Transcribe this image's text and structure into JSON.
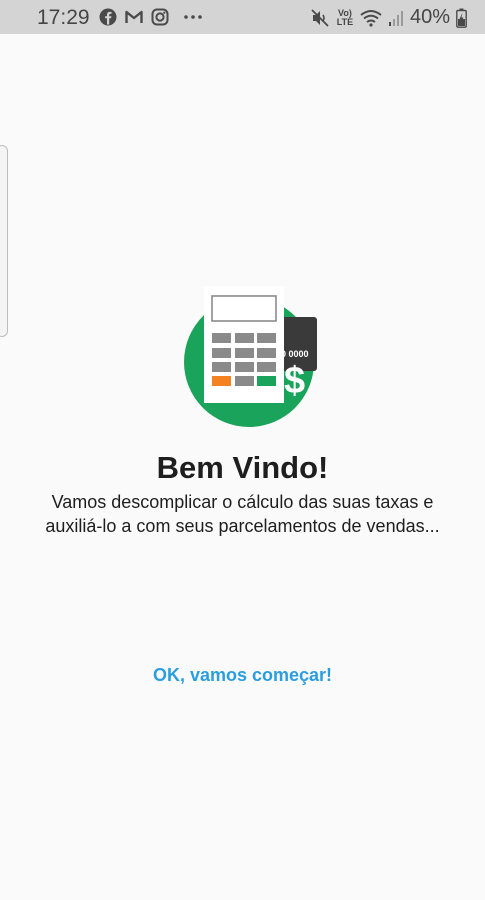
{
  "status_bar": {
    "time": "17:29",
    "battery_percent": "40%",
    "volte_top": "Vo)",
    "volte_bottom": "LTE",
    "left_icons": [
      "facebook-icon",
      "gmail-icon",
      "instagram-icon",
      "more-dots-icon"
    ],
    "right_icons": [
      "mute-vibrate-icon",
      "volte-icon",
      "wifi-icon",
      "signal-icon",
      "battery-charging-icon"
    ]
  },
  "illustration": {
    "name": "calculator-card-illustration",
    "colors": {
      "circle": "#1aa35a",
      "calculator_body": "#ffffff",
      "key": "#8a8a8a",
      "key_orange": "#f58220",
      "key_green": "#1aa35a",
      "card": "#3a3a3a",
      "dollar": "#ffffff"
    },
    "card_number_fragment": "0 0000",
    "dollar_sign": "$"
  },
  "welcome": {
    "title": "Bem Vindo!",
    "description": "Vamos descomplicar o cálculo das suas taxas e auxiliá-lo a com seus parcelamentos de vendas..."
  },
  "actions": {
    "start_label": "OK, vamos começar!",
    "start_color": "#2a9ee0"
  }
}
